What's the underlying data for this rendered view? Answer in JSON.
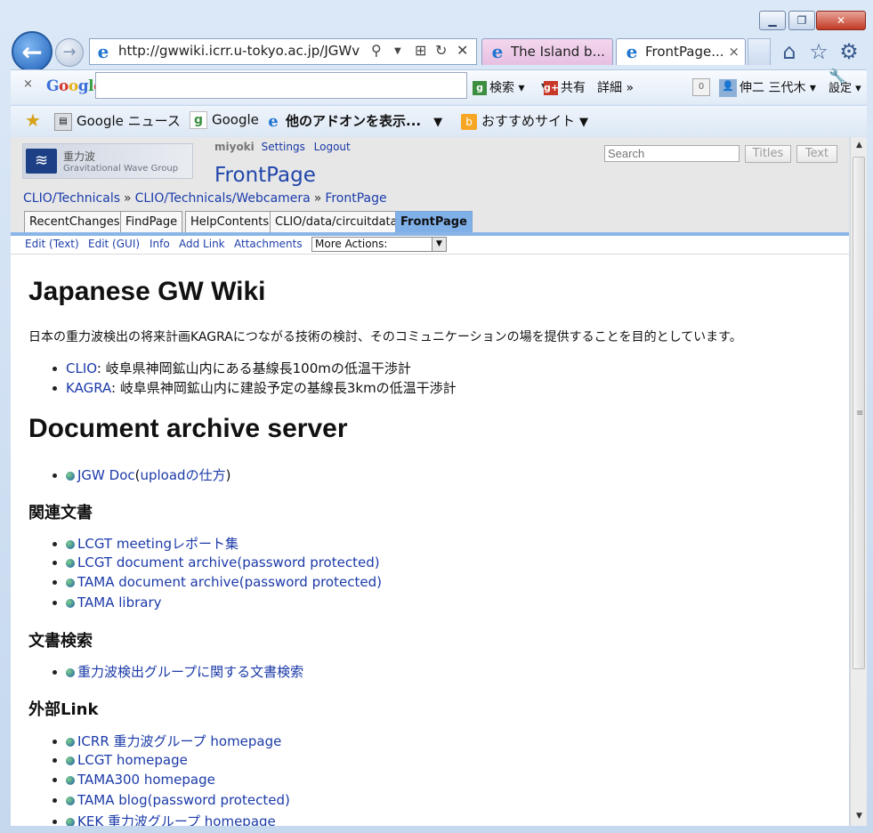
{
  "window": {
    "minimize_label": "▁",
    "maximize_label": "❐",
    "close_label": "✕"
  },
  "browser": {
    "url": "http://gwwiki.icrr.u-tokyo.ac.jp/JGWv",
    "tabs": [
      {
        "label": "The Island b..."
      },
      {
        "label": "FrontPage..."
      }
    ],
    "tab_close": "×"
  },
  "google_toolbar": {
    "close": "×",
    "logo": "Google",
    "search_label": "検索",
    "share_label": "共有",
    "more_label": "詳細 »",
    "badge_count": "0",
    "user_name": "伸二 三代木",
    "settings_label": "設定"
  },
  "favorites": [
    {
      "label": "Google ニュース"
    },
    {
      "label": "Google"
    },
    {
      "label": "他のアドオンを表示..."
    },
    {
      "label": "おすすめサイト"
    }
  ],
  "wiki": {
    "logo_line1": "重力波",
    "logo_line2": "Gravitational Wave Group",
    "user": "miyoki",
    "settings": "Settings",
    "logout": "Logout",
    "page_title": "FrontPage",
    "search_placeholder": "Search",
    "titles_btn": "Titles",
    "text_btn": "Text",
    "breadcrumb": [
      "CLIO/Technicals",
      "CLIO/Technicals/Webcamera",
      "FrontPage"
    ],
    "breadcrumb_sep": "»",
    "nav_tabs": [
      "RecentChanges",
      "FindPage",
      "HelpContents",
      "CLIO/data/circuitdata",
      "FrontPage"
    ],
    "actions": [
      "Edit (Text)",
      "Edit (GUI)",
      "Info",
      "Add Link",
      "Attachments"
    ],
    "more_actions": "More Actions:"
  },
  "content": {
    "h1_wiki": "Japanese GW Wiki",
    "intro": "日本の重力波検出の将来計画KAGRAにつながる技術の検討、そのコミュニケーションの場を提供することを目的としています。",
    "projects": [
      {
        "link": "CLIO",
        "text": ": 岐阜県神岡鉱山内にある基線長100mの低温干渉計"
      },
      {
        "link": "KAGRA",
        "text": ": 岐阜県神岡鉱山内に建設予定の基線長3kmの低温干渉計"
      }
    ],
    "h1_docs": "Document archive server",
    "jgw_doc": {
      "link": "JGW Doc",
      "open": "(",
      "link2": "uploadの仕方",
      "close": ")"
    },
    "h2_related": "関連文書",
    "related": [
      "LCGT meetingレポート集",
      "LCGT document archive(password protected)",
      "TAMA document archive(password protected)",
      "TAMA library"
    ],
    "h2_search": "文書検索",
    "search_links": [
      "重力波検出グループに関する文書検索"
    ],
    "h2_external": "外部Link",
    "external": [
      "ICRR 重力波グループ homepage",
      "LCGT homepage",
      "TAMA300 homepage",
      "TAMA blog(password protected)",
      "KEK 重力波グループ homepage"
    ]
  }
}
